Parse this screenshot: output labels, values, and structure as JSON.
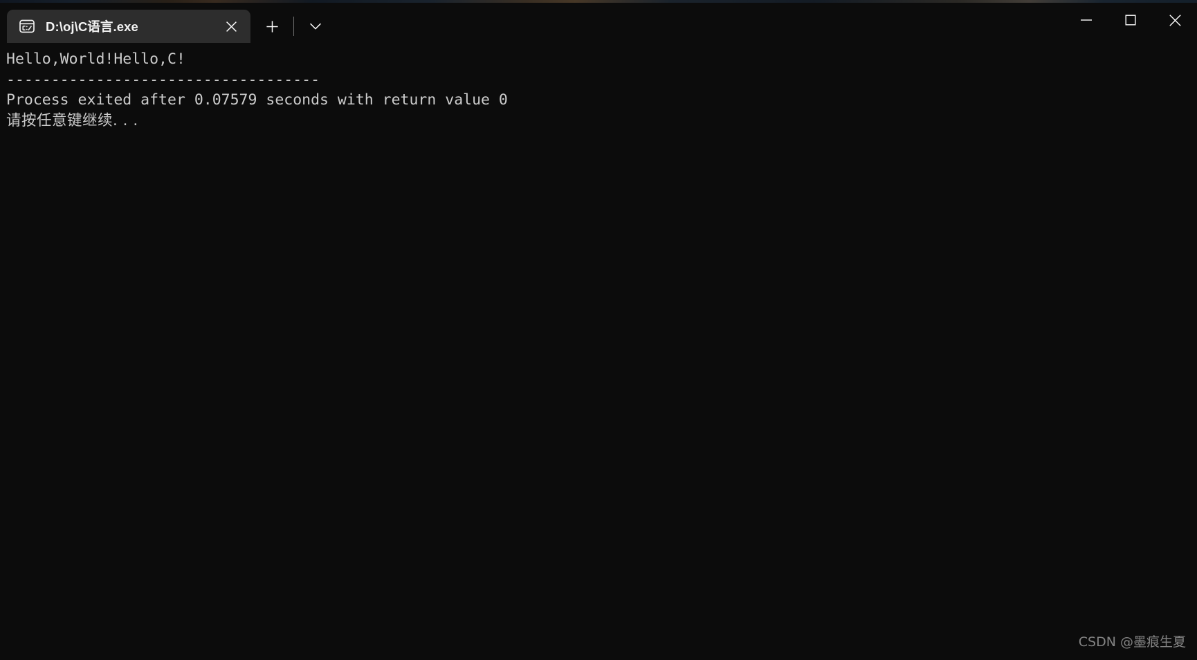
{
  "window": {
    "titlebar_bg": "#0c0c0c",
    "tab_active_bg": "#2d2d2d",
    "terminal_bg": "#0c0c0c",
    "text_color": "#cccccc",
    "tab": {
      "icon": "console-cmd-icon",
      "icon_label": "C:\\",
      "title": "D:\\oj\\C语言.exe",
      "close_icon": "close-icon"
    },
    "actions": {
      "new_tab_icon": "plus-icon",
      "new_tab_label": "+",
      "dropdown_icon": "chevron-down-icon"
    },
    "controls": {
      "minimize_icon": "minimize-icon",
      "maximize_icon": "maximize-icon",
      "close_icon": "close-icon"
    }
  },
  "terminal": {
    "lines": [
      "Hello,World!Hello,C!",
      "-----------------------------------",
      "Process exited after 0.07579 seconds with return value 0",
      "请按任意键继续. . ."
    ]
  },
  "watermark": {
    "text": "CSDN @墨痕生夏"
  }
}
